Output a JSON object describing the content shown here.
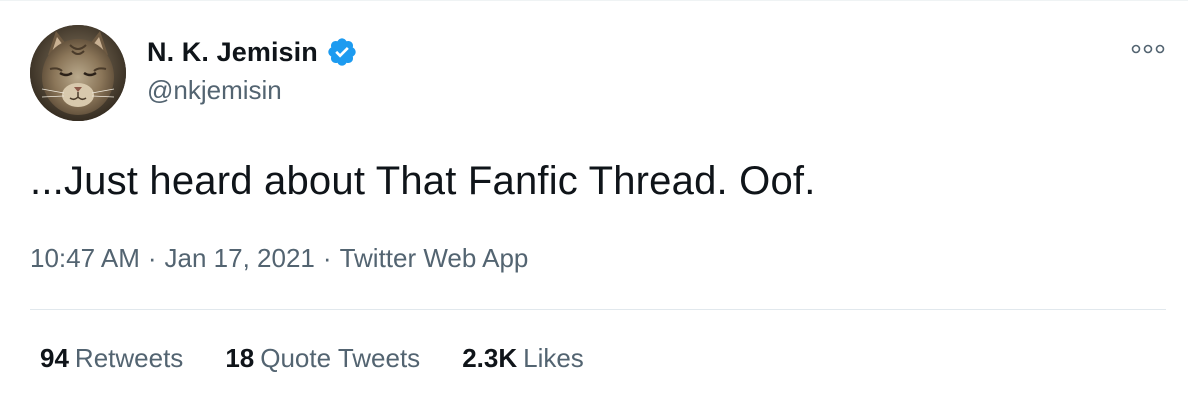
{
  "author": {
    "display_name": "N. K. Jemisin",
    "handle": "@nkjemisin",
    "verified_icon": "verified-badge-icon",
    "avatar": "cat-photo"
  },
  "colors": {
    "accent": "#1d9bf0",
    "text_primary": "#0f1419",
    "text_secondary": "#536471"
  },
  "menu": {
    "icon": "more-options-icon"
  },
  "tweet": {
    "text": "...Just heard about That Fanfic Thread. Oof.",
    "time": "10:47 AM",
    "date": "Jan 17, 2021",
    "source": "Twitter Web App",
    "separator": "·"
  },
  "stats": [
    {
      "count": "94",
      "label": "Retweets"
    },
    {
      "count": "18",
      "label": "Quote Tweets"
    },
    {
      "count": "2.3K",
      "label": "Likes"
    }
  ]
}
